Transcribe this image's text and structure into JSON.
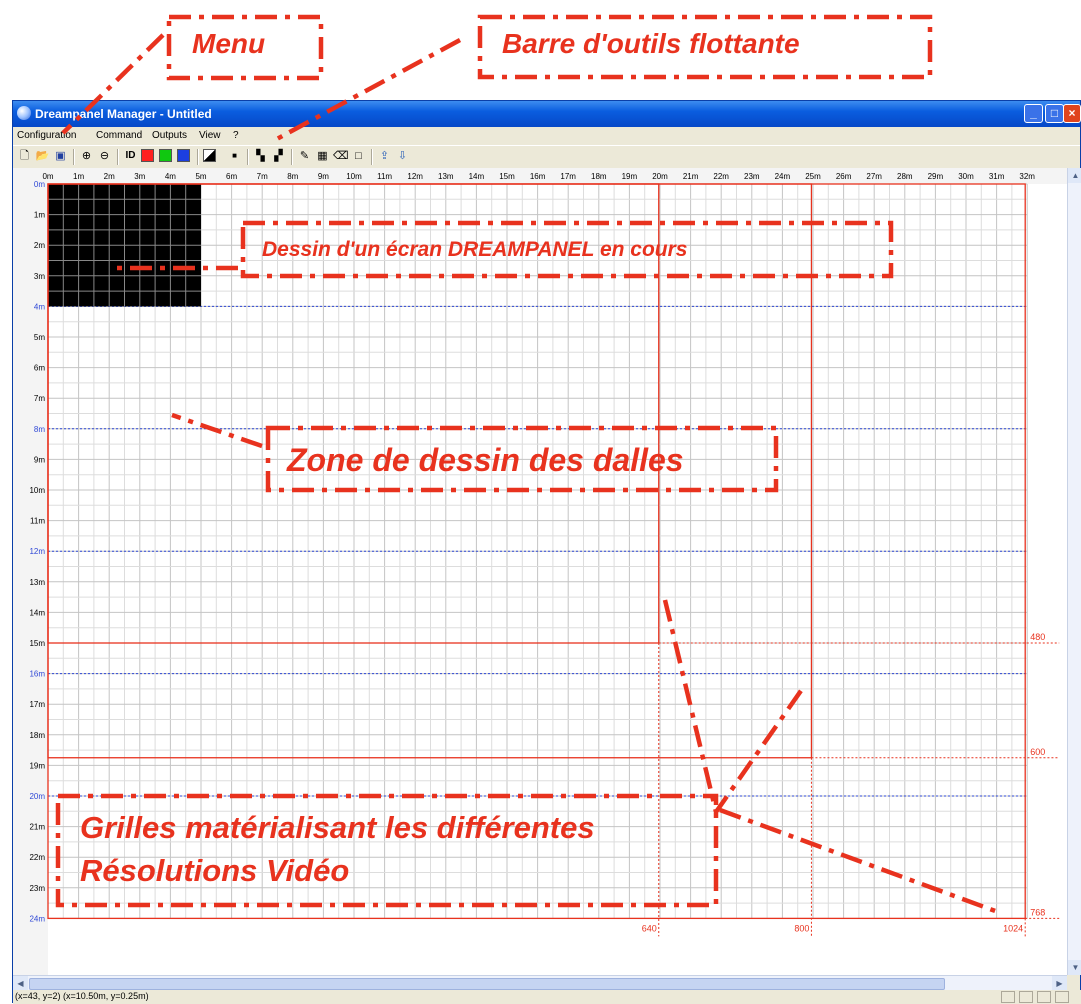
{
  "window": {
    "title": "Dreampanel Manager - Untitled"
  },
  "menu": [
    "Configuration",
    "Command",
    "Outputs",
    "View",
    "?"
  ],
  "toolbar": {
    "id_label": "ID",
    "icons": [
      "new-file-icon",
      "open-file-icon",
      "save-icon",
      "zoom-in-icon",
      "zoom-out-icon",
      "id-icon",
      "red-color-swatch",
      "green-color-swatch",
      "blue-color-swatch",
      "white-black-icon",
      "point-icon",
      "grid-tiles-icon",
      "grid-tiles-alt-icon",
      "pencil-icon",
      "fill-icon",
      "eraser-icon",
      "rectangle-icon",
      "export-icon",
      "import-icon"
    ],
    "colors": {
      "red": "#ff2020",
      "green": "#10c810",
      "blue": "#1c3fe0"
    }
  },
  "ruler": {
    "x_labels": [
      "0m",
      "1m",
      "2m",
      "3m",
      "4m",
      "5m",
      "6m",
      "7m",
      "8m",
      "9m",
      "10m",
      "11m",
      "12m",
      "13m",
      "14m",
      "15m",
      "16m",
      "17m",
      "18m",
      "19m",
      "20m",
      "21m",
      "22m",
      "23m",
      "24m",
      "25m",
      "26m",
      "27m",
      "28m",
      "29m",
      "30m",
      "31m",
      "32m"
    ],
    "y_labels": [
      "0m",
      "1m",
      "2m",
      "3m",
      "4m",
      "5m",
      "6m",
      "7m",
      "8m",
      "9m",
      "10m",
      "11m",
      "12m",
      "13m",
      "14m",
      "15m",
      "16m",
      "17m",
      "18m",
      "19m",
      "20m",
      "21m",
      "22m",
      "23m",
      "24m"
    ],
    "highlight_every_m": 4
  },
  "resolution_grids": {
    "widths": [
      "640",
      "800",
      "1024"
    ],
    "heights": [
      "480",
      "600",
      "768"
    ]
  },
  "status": {
    "text": "(x=43, y=2) (x=10.50m, y=0.25m)"
  },
  "annotations": {
    "menu": "Menu",
    "toolbar": "Barre d'outils flottante",
    "drawing": "Dessin d'un écran DREAMPANEL en cours",
    "zone": "Zone de dessin des dalles",
    "grids_line1": "Grilles matérialisant les différentes",
    "grids_line2": "Résolutions Vidéo"
  },
  "colors": {
    "accent_red": "#e8321e",
    "grid_gray": "#c8c8c8",
    "ruler_blue": "#2f48d6"
  }
}
